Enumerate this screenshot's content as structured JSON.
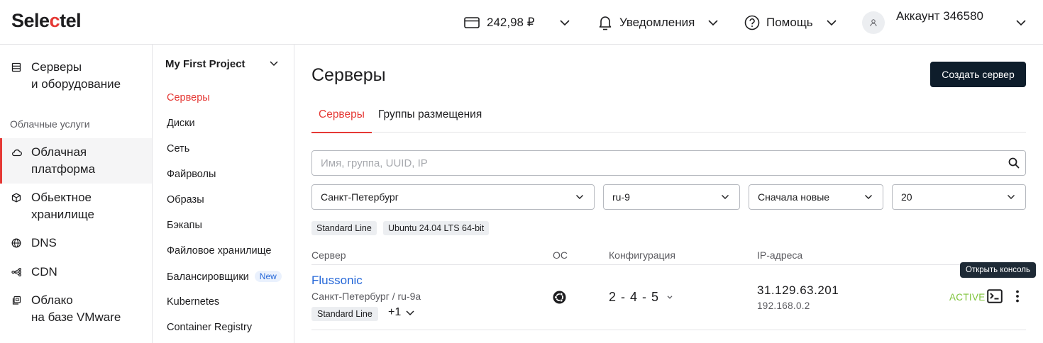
{
  "header": {
    "logo_part1": "Sele",
    "logo_part2": "c",
    "logo_part3": "tel",
    "balance": "242,98 ₽",
    "notifications": "Уведомления",
    "help": "Помощь",
    "account": "Аккаунт 346580"
  },
  "sidebar": {
    "section_label": "Облачные услуги",
    "items": [
      {
        "line1": "Серверы",
        "line2": "и оборудование"
      },
      {
        "line1": "Облачная",
        "line2": "платформа"
      },
      {
        "line1": "Обьектное",
        "line2": "хранилище"
      },
      {
        "line1": "DNS",
        "line2": ""
      },
      {
        "line1": "CDN",
        "line2": ""
      },
      {
        "line1": "Облако",
        "line2": "на базе VMware"
      }
    ]
  },
  "project": {
    "title": "My First Project",
    "items": [
      {
        "label": "Серверы"
      },
      {
        "label": "Диски"
      },
      {
        "label": "Сеть"
      },
      {
        "label": "Файрволы"
      },
      {
        "label": "Образы"
      },
      {
        "label": "Бэкапы"
      },
      {
        "label": "Файловое хранилище"
      },
      {
        "label": "Балансировщики",
        "badge": "New"
      },
      {
        "label": "Kubernetes"
      },
      {
        "label": "Container Registry"
      }
    ]
  },
  "main": {
    "title": "Серверы",
    "create_button": "Создать сервер",
    "tabs": [
      {
        "label": "Серверы"
      },
      {
        "label": "Группы размещения"
      }
    ],
    "search_placeholder": "Имя, группа, UUID, IP",
    "filters": {
      "region": "Санкт-Петербург",
      "zone": "ru-9",
      "sort": "Сначала новые",
      "per_page": "20"
    },
    "chips": [
      "Standard Line",
      "Ubuntu 24.04 LTS 64-bit"
    ],
    "columns": [
      "Сервер",
      "ОС",
      "Конфигурация",
      "IP-адреса"
    ],
    "server": {
      "name": "Flussonic",
      "location": "Санкт-Петербург / ru-9a",
      "line": "Standard Line",
      "more": "+1",
      "os_icon": "ubuntu-icon",
      "config": "2 - 4 - 5",
      "ip_public": "31.129.63.201",
      "ip_private": "192.168.0.2",
      "status": "ACTIVE",
      "console_tooltip": "Открыть консоль"
    }
  },
  "colors": {
    "accent_red": "#e53935",
    "link_blue": "#2668d8",
    "status_green": "#7ec33a",
    "button_dark": "#0e1d2b"
  }
}
